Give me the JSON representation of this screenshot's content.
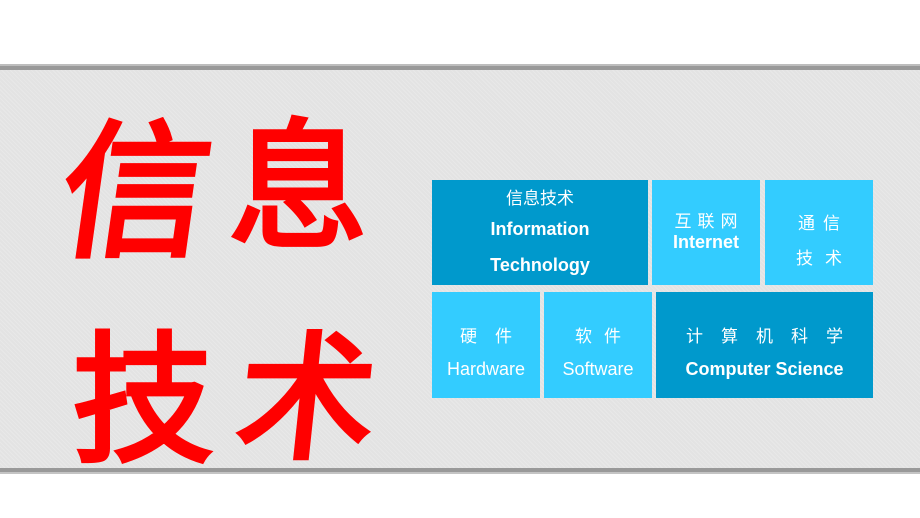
{
  "title": {
    "chars": [
      "信",
      "息",
      "技",
      "术"
    ],
    "color": "#ff0000"
  },
  "tiles": {
    "information_technology": {
      "zh": "信息技术",
      "en_line1": "Information",
      "en_line2": "Technology",
      "color": "#0099cc"
    },
    "internet": {
      "zh": "互联网",
      "en": "Internet",
      "color": "#33ccff"
    },
    "communication_technology": {
      "zh_line1": "通信",
      "zh_line2": "技术",
      "color": "#33ccff"
    },
    "hardware": {
      "zh": "硬件",
      "en": "Hardware",
      "color": "#33ccff"
    },
    "software": {
      "zh": "软件",
      "en": "Software",
      "color": "#33ccff"
    },
    "computer_science": {
      "zh": "计算机科学",
      "en": "Computer Science",
      "color": "#0099cc"
    }
  }
}
